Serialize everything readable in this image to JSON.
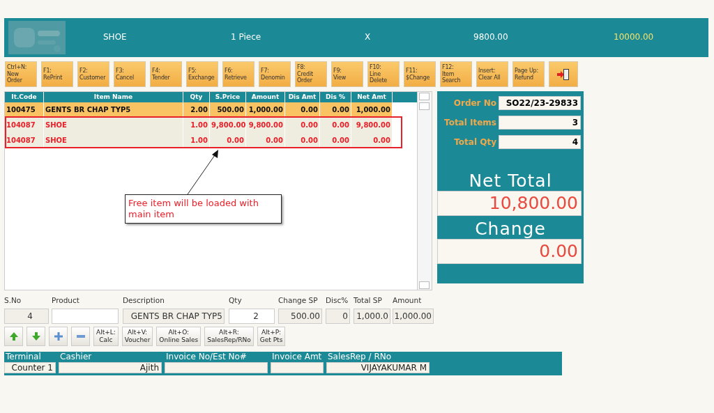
{
  "banner": {
    "item": "SHOE",
    "quantity": "1 Piece",
    "multiplier": "X",
    "price": "9800.00",
    "amount": "10000.00"
  },
  "toolbar": [
    {
      "kind": "text",
      "label": "Ctrl+N:\nNew\nOrder"
    },
    {
      "kind": "text",
      "label": "F1:\nRePrint"
    },
    {
      "kind": "text",
      "label": "F2:\nCustomer"
    },
    {
      "kind": "text",
      "label": "F3:\nCancel"
    },
    {
      "kind": "text",
      "label": "F4:\nTender"
    },
    {
      "kind": "text",
      "label": "F5:\nExchange"
    },
    {
      "kind": "text",
      "label": "F6:\nRetrieve"
    },
    {
      "kind": "text",
      "label": "F7:\nDenomin"
    },
    {
      "kind": "text",
      "label": "F8:\nCredit\nOrder"
    },
    {
      "kind": "text",
      "label": "F9:\nView"
    },
    {
      "kind": "text",
      "label": "F10:\nLine\nDelete"
    },
    {
      "kind": "text",
      "label": "F11:\n$Change"
    },
    {
      "kind": "text",
      "label": "F12:\nItem\nSearch"
    },
    {
      "kind": "text",
      "label": "Insert:\nClear All"
    },
    {
      "kind": "text",
      "label": "Page Up:\nRefund"
    },
    {
      "kind": "exit"
    }
  ],
  "table": {
    "columns": [
      "It.Code",
      "Item Name",
      "Qty",
      "S.Price",
      "Amount",
      "Dis Amt",
      "Dis %",
      "Net Amt"
    ],
    "rows": [
      {
        "selected": true,
        "kind": "normal",
        "cells": [
          "100475",
          "GENTS BR CHAP TYP5",
          "2.00",
          "500.00",
          "1,000.00",
          "0.00",
          "0.00",
          "1,000.00"
        ]
      },
      {
        "selected": false,
        "kind": "offer",
        "cells": [
          "104087",
          "SHOE",
          "1.00",
          "9,800.00",
          "9,800.00",
          "0.00",
          "0.00",
          "9,800.00"
        ]
      },
      {
        "selected": false,
        "kind": "offer",
        "cells": [
          "104087",
          "SHOE",
          "1.00",
          "0.00",
          "0.00",
          "0.00",
          "0.00",
          "0.00"
        ]
      }
    ]
  },
  "annotation": {
    "text": "Free item will be loaded with main item"
  },
  "summary": {
    "fields": [
      {
        "label": "Order No",
        "value": "SO22/23-29833"
      },
      {
        "label": "Total Items",
        "value": "3"
      },
      {
        "label": "Total Qty",
        "value": "4"
      }
    ],
    "net_total": {
      "label": "Net Total",
      "value": "10,800.00"
    },
    "change": {
      "label": "Change",
      "value": "0.00"
    }
  },
  "entry": {
    "fields": [
      {
        "label": "S.No",
        "value": "4"
      },
      {
        "label": "Product"
      },
      {
        "label": "Description",
        "value": "GENTS BR CHAP TYP5"
      },
      {
        "label": "Qty",
        "value": "2"
      },
      {
        "label": "Change SP",
        "value": "500.00"
      },
      {
        "label": "Disc%",
        "value": "0"
      },
      {
        "label": "Total SP",
        "value": "1,000.0"
      },
      {
        "label": "Amount",
        "value": "1,000.00"
      }
    ],
    "buttons": [
      {
        "kind": "up"
      },
      {
        "kind": "down"
      },
      {
        "kind": "plus"
      },
      {
        "kind": "minus"
      },
      {
        "kind": "text",
        "label": "Alt+L:\nCalc"
      },
      {
        "kind": "text",
        "label": "Alt+V:\nVoucher"
      },
      {
        "kind": "text",
        "label": "Alt+O:\nOnline Sales"
      },
      {
        "kind": "text",
        "label": "Alt+R:\nSalesRep/RNo"
      },
      {
        "kind": "text",
        "label": "Alt+P:\nGet Pts"
      }
    ]
  },
  "footer": [
    {
      "label": "Terminal",
      "value": "Counter 1"
    },
    {
      "label": "Cashier",
      "value": "Ajith"
    },
    {
      "label": "Invoice No/Est No#"
    },
    {
      "label": "Invoice Amt"
    },
    {
      "label": "SalesRep / RNo",
      "value": "VIJAYAKUMAR M"
    }
  ]
}
